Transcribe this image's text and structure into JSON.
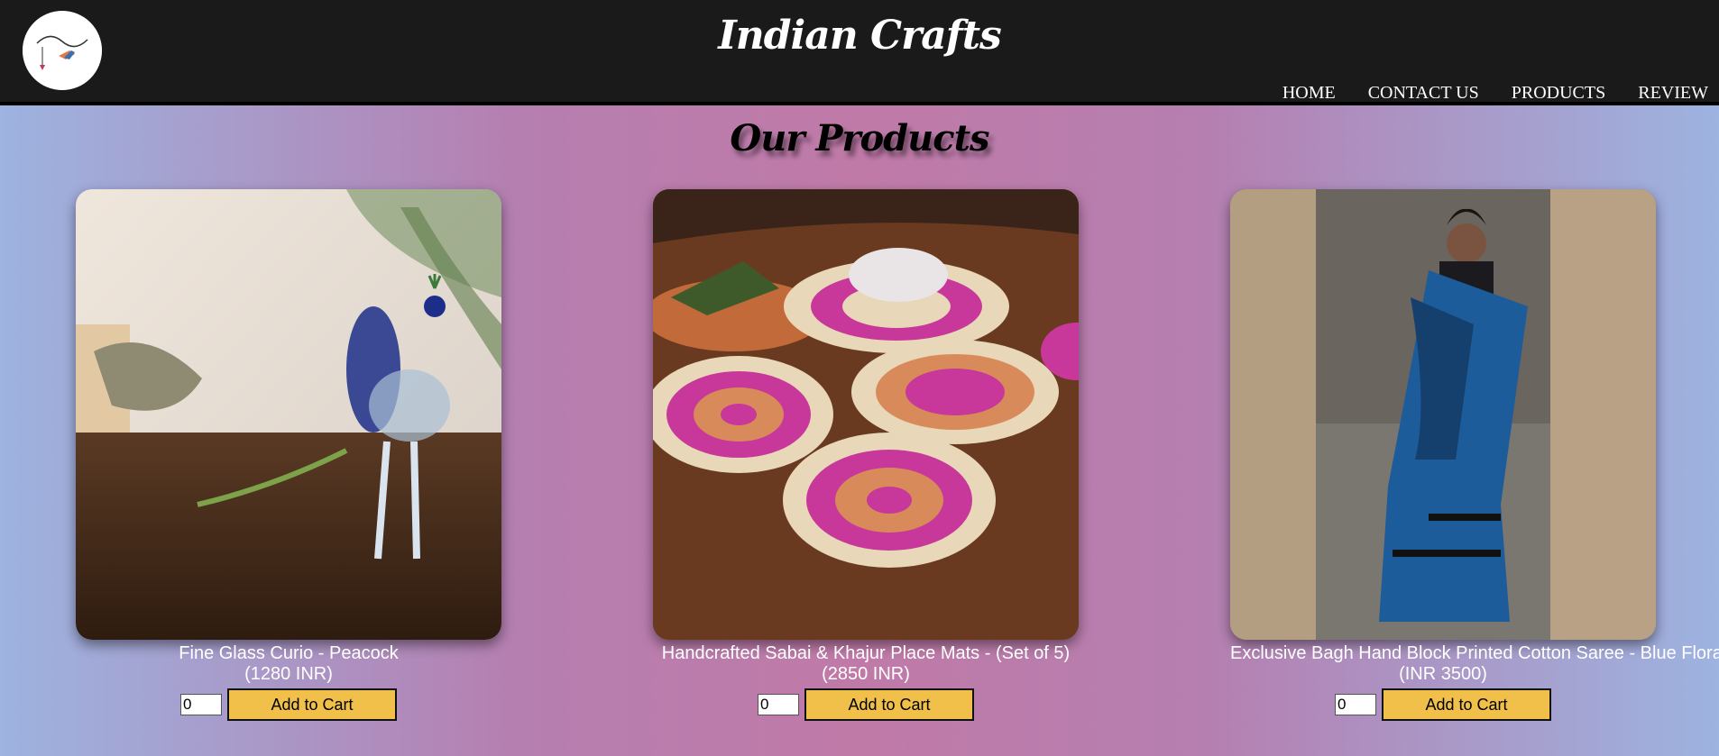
{
  "header": {
    "site_title": "Indian Crafts",
    "logo_text": "Indian Crafts"
  },
  "nav": [
    {
      "label": "HOME"
    },
    {
      "label": "CONTACT US"
    },
    {
      "label": "PRODUCTS"
    },
    {
      "label": "REVIEW"
    }
  ],
  "main": {
    "title": "Our Products",
    "products": [
      {
        "name": "Fine Glass Curio - Peacock",
        "price": "(1280 INR)",
        "qty": "0",
        "button": "Add to Cart"
      },
      {
        "name": "Handcrafted Sabai & Khajur Place Mats - (Set of 5)",
        "price": "(2850 INR)",
        "qty": "0",
        "button": "Add to Cart"
      },
      {
        "name": "Exclusive Bagh Hand Block Printed Cotton Saree - Blue Floral",
        "price": "(INR 3500)",
        "qty": "0",
        "button": "Add to Cart"
      }
    ]
  },
  "colors": {
    "header_bg": "#1a1a1a",
    "button_bg": "#f0c04a"
  }
}
